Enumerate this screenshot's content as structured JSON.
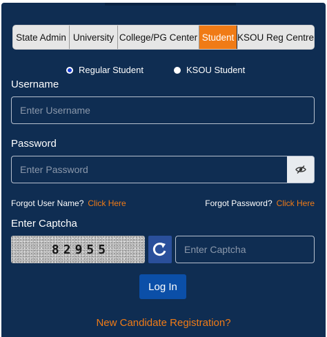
{
  "tabs": [
    {
      "label": "State Admin",
      "active": false
    },
    {
      "label": "University",
      "active": false
    },
    {
      "label": "College/PG Center",
      "active": false
    },
    {
      "label": "Student",
      "active": true
    },
    {
      "label": "KSOU Reg Centre",
      "active": false
    }
  ],
  "user_type": {
    "options": [
      {
        "label": "Regular Student",
        "checked": true
      },
      {
        "label": "KSOU Student",
        "checked": false
      }
    ]
  },
  "username": {
    "label": "Username",
    "value": "",
    "placeholder": "Enter Username"
  },
  "password": {
    "label": "Password",
    "value": "",
    "placeholder": "Enter Password",
    "toggle_icon": "eye-slash-icon"
  },
  "forgot": {
    "user_text": "Forgot User Name?",
    "user_link": "Click Here",
    "password_text": "Forgot Password?",
    "password_link": "Click Here"
  },
  "captcha": {
    "label": "Enter Captcha",
    "code": "82955",
    "refresh_icon": "refresh-icon",
    "input_value": "",
    "placeholder": "Enter Captcha"
  },
  "login": {
    "label": "Log In"
  },
  "register": {
    "label": "New Candidate Registration?"
  },
  "colors": {
    "panel_background": "#0f2d52",
    "accent_orange": "#f07b16",
    "login_blue": "#0b4fa8",
    "refresh_blue": "#2a4f9b"
  }
}
